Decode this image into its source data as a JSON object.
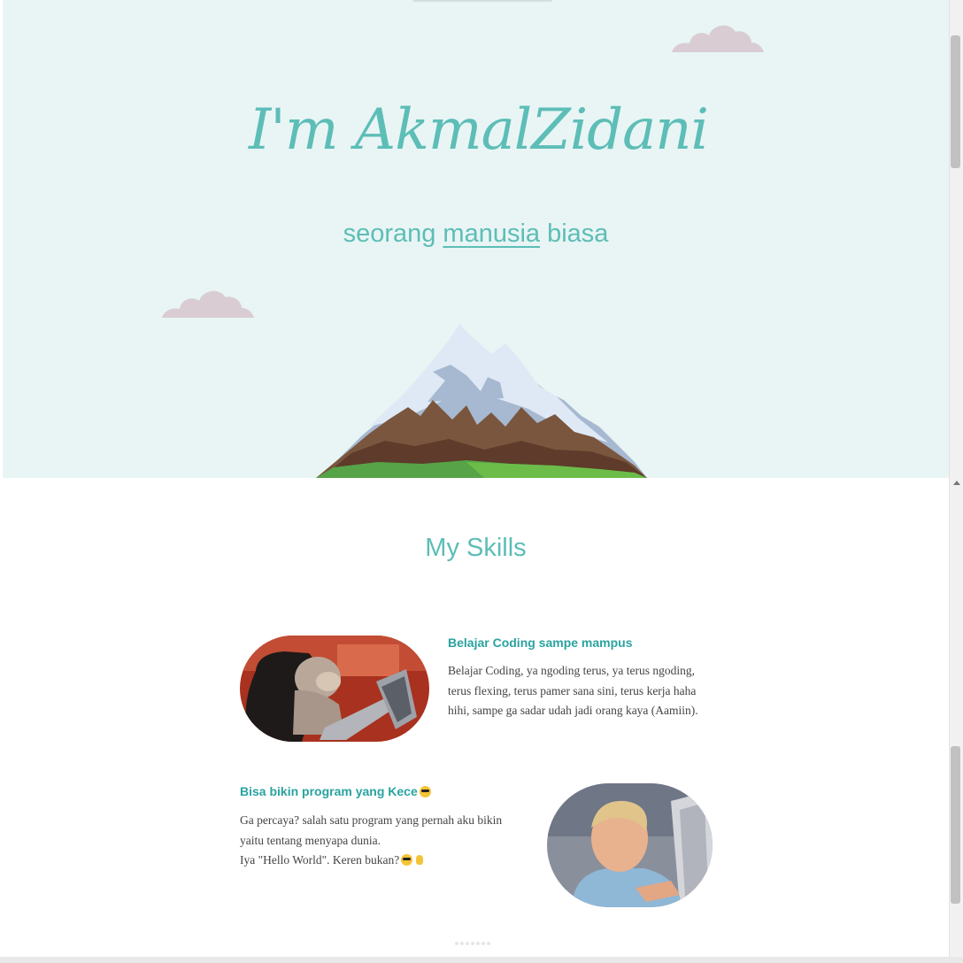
{
  "hero": {
    "title": "I'm AkmalZidani",
    "subtitle_pre": "seorang ",
    "subtitle_link": "manusia",
    "subtitle_post": " biasa",
    "background": "#e8f5f4",
    "accent": "#5dbdb7"
  },
  "skills": {
    "title": "My Skills",
    "items": [
      {
        "heading": "Belajar Coding sampe mampus",
        "text": "Belajar Coding, ya ngoding terus, ya terus ngoding, terus flexing, terus pamer sana sini, terus kerja haha hihi, sampe ga sadar udah jadi orang kaya (Aamiin).",
        "image_icon": "monkey-laptop-image"
      },
      {
        "heading": "Bisa bikin program yang Kece",
        "heading_emoji": "sunglasses-emoji-icon",
        "text_line1": "Ga percaya? salah satu program yang pernah aku bikin yaitu tentang menyapa dunia.",
        "text_line2": "Iya \"Hello World\". Keren bukan?",
        "text_emojis": [
          "sunglasses-emoji-icon",
          "ok-hand-emoji-icon"
        ],
        "image_icon": "boy-computer-image"
      }
    ]
  },
  "carousel": {
    "dot_count": 7
  },
  "colors": {
    "heading_teal": "#2aa3a0",
    "cloud": "#d9ccd3",
    "snow": "#dfe9f5",
    "rock": "#7a563e",
    "grass": "#56a447"
  }
}
